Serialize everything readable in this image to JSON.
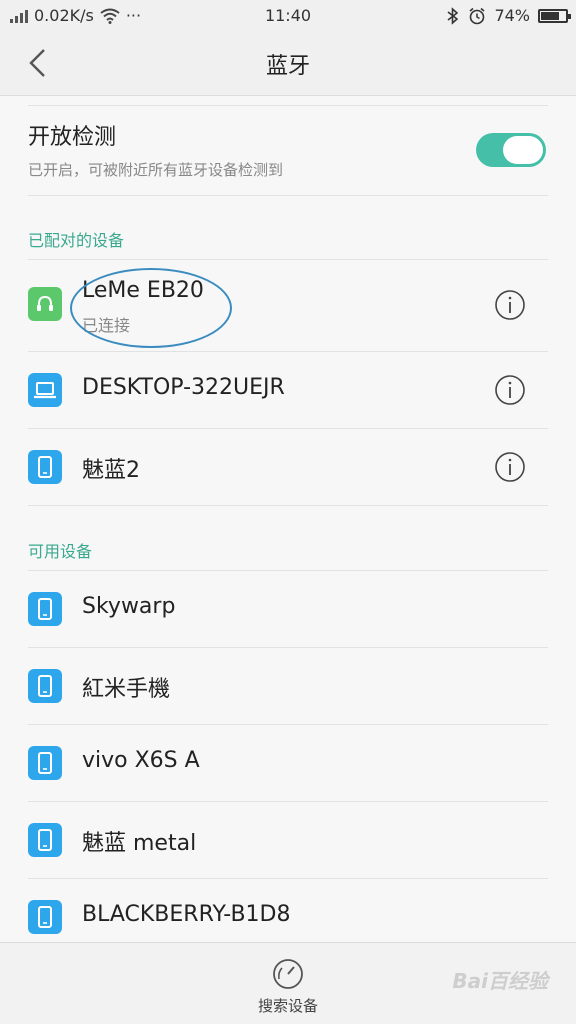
{
  "status_bar": {
    "network_speed": "0.02K/s",
    "dots": "···",
    "time": "11:40",
    "battery_percent": "74%",
    "battery_level": 0.74
  },
  "header": {
    "title": "蓝牙"
  },
  "visibility": {
    "title": "开放检测",
    "subtitle": "已开启，可被附近所有蓝牙设备检测到",
    "enabled": true
  },
  "paired_section": {
    "header": "已配对的设备",
    "devices": [
      {
        "name": "LeMe EB20",
        "status": "已连接",
        "icon": "headset-icon"
      },
      {
        "name": "DESKTOP-322UEJR",
        "icon": "laptop-icon"
      },
      {
        "name": "魅蓝2",
        "icon": "phone-icon"
      }
    ]
  },
  "available_section": {
    "header": "可用设备",
    "devices": [
      {
        "name": "Skywarp",
        "icon": "phone-icon"
      },
      {
        "name": "紅米手機",
        "icon": "phone-icon"
      },
      {
        "name": "vivo X6S A",
        "icon": "phone-icon"
      },
      {
        "name": "魅蓝 metal",
        "icon": "phone-icon"
      },
      {
        "name": "BLACKBERRY-B1D8",
        "icon": "phone-icon"
      }
    ]
  },
  "bottom_bar": {
    "search_label": "搜索设备"
  },
  "watermark": "Bai百经验",
  "colors": {
    "accent": "#46bfa8",
    "section_header": "#3aa88f",
    "device_icon": "#2ea6ec",
    "connected_icon": "#5bc86b",
    "annotation": "#3a8cc0"
  }
}
